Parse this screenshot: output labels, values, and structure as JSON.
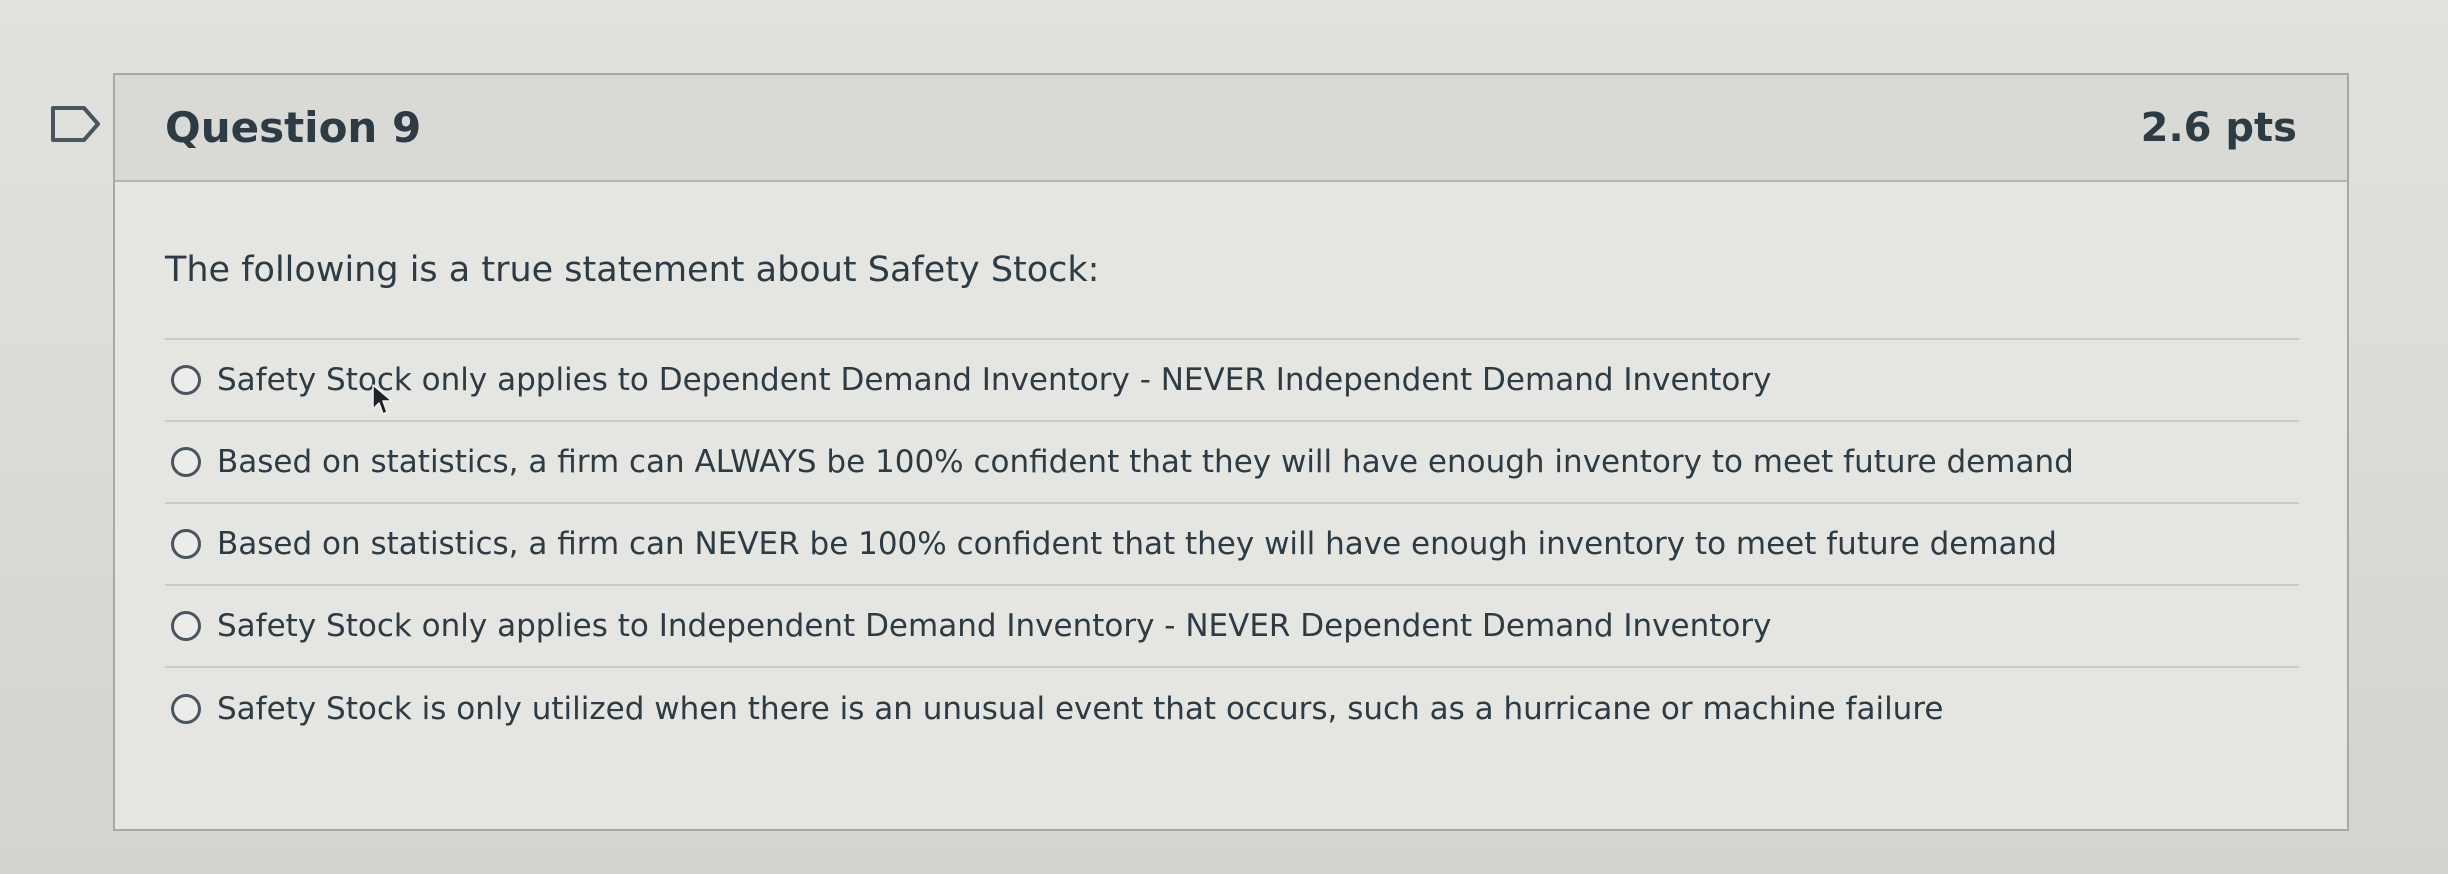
{
  "question": {
    "title": "Question 9",
    "points": "2.6 pts",
    "flag_icon": "flag-outline-icon",
    "prompt": "The following is a true statement about Safety Stock:",
    "answers": [
      {
        "label": "Safety Stock only applies to Dependent Demand Inventory - NEVER Independent Demand Inventory",
        "selected": false
      },
      {
        "label": "Based on statistics, a firm can ALWAYS be 100% confident that they will have enough inventory to meet future demand",
        "selected": false
      },
      {
        "label": "Based on statistics, a firm can NEVER be 100% confident that they will have enough inventory to meet future demand",
        "selected": false
      },
      {
        "label": "Safety Stock only applies to Independent Demand Inventory - NEVER Dependent Demand Inventory",
        "selected": false
      },
      {
        "label": "Safety Stock is only utilized when there is an unusual event that occurs, such as a hurricane or machine failure",
        "selected": false
      }
    ]
  },
  "colors": {
    "text": "#2d3b45",
    "header_bg": "#d9d9d6",
    "card_bg": "#e5e5e2",
    "border": "#a6a8a6"
  }
}
